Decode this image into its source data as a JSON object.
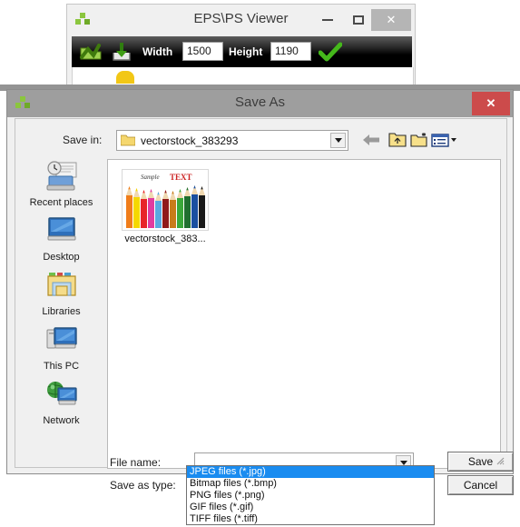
{
  "viewer": {
    "title": "EPS\\PS Viewer",
    "logo_icon": "green-cubes-logo-icon",
    "controls": {
      "minimize": "minimize-icon",
      "maximize": "maximize-icon",
      "close": "✕"
    },
    "toolbar": {
      "open_icon": "open-folder-check-icon",
      "save_icon": "save-download-icon",
      "width_label": "Width",
      "width_value": "1500",
      "height_label": "Height",
      "height_value": "1190",
      "apply_icon": "green-check-icon"
    }
  },
  "dialog": {
    "title": "Save As",
    "logo_icon": "green-cubes-logo-icon",
    "close_label": "✕",
    "save_in": {
      "label": "Save in:",
      "value": "vectorstock_383293",
      "folder_icon": "folder-icon",
      "dropdown_icon": "chevron-down-icon"
    },
    "nav": {
      "back": "back-arrow-icon",
      "up": "up-folder-icon",
      "new_folder": "new-folder-icon",
      "views": "views-list-icon"
    },
    "places": [
      {
        "label": "Recent places",
        "icon": "recent-places-icon"
      },
      {
        "label": "Desktop",
        "icon": "desktop-icon"
      },
      {
        "label": "Libraries",
        "icon": "libraries-icon"
      },
      {
        "label": "This PC",
        "icon": "this-pc-icon"
      },
      {
        "label": "Network",
        "icon": "network-icon"
      }
    ],
    "files": [
      {
        "name": "vectorstock_383...",
        "thumb_sample_text": "Sample",
        "thumb_text": "TEXT",
        "icon": "file-thumbnail"
      }
    ],
    "form": {
      "file_name_label": "File name:",
      "file_name_value": "",
      "save_type_label": "Save as type:",
      "save_type_value": "JPEG files (*.jpg)"
    },
    "buttons": {
      "save": "Save",
      "cancel": "Cancel"
    },
    "type_dropdown": {
      "selected_index": 0,
      "options": [
        "JPEG files (*.jpg)",
        "Bitmap files (*.bmp)",
        "PNG files (*.png)",
        "GIF files (*.gif)",
        "TIFF files (*.tiff)"
      ]
    }
  },
  "colors": {
    "dialog_titlebar": "#9e9e9e",
    "close_red": "#cc4b4b",
    "selection_blue": "#1a8cf0",
    "toolbar_black": "#000000",
    "window_gray": "#f0f0f0"
  }
}
